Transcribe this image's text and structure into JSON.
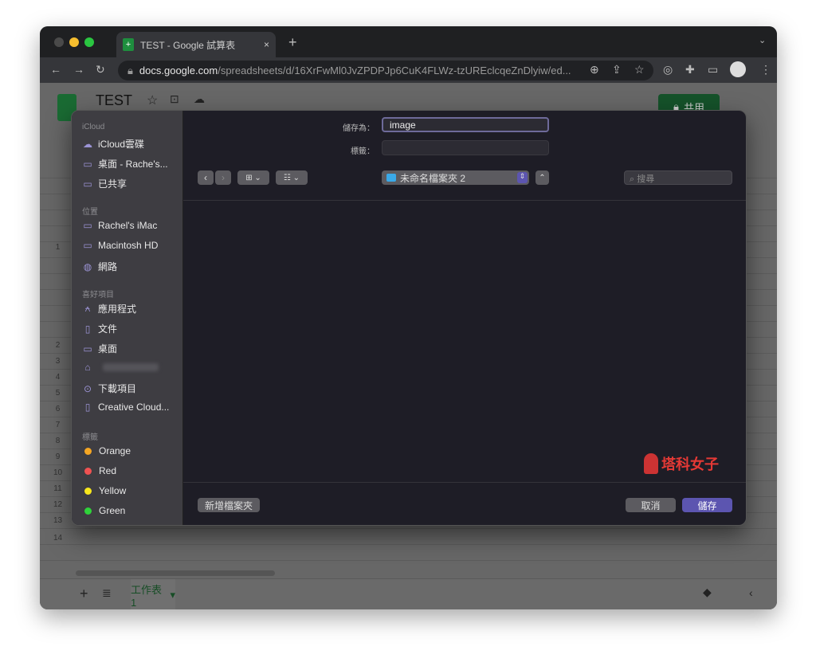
{
  "browser": {
    "tab_title": "TEST - Google 試算表",
    "url_host": "docs.google.com",
    "url_path": "/spreadsheets/d/16XrFwMl0JvZPDPJp6CuK4FLWz-tzUREclcqeZnDlyiw/ed..."
  },
  "sheets": {
    "doc_title": "TEST",
    "share_label": "共用",
    "sheet_tab": "工作表1",
    "row_numbers": [
      "1",
      "2",
      "3",
      "4",
      "5",
      "6",
      "7",
      "8",
      "9",
      "10",
      "11",
      "12",
      "13",
      "14"
    ]
  },
  "dialog": {
    "save_as_label": "儲存為：",
    "save_as_value": "image",
    "tags_label": "標籤：",
    "tags_value": "",
    "folder": "未命名檔案夾 2",
    "search_placeholder": "搜尋",
    "new_folder": "新增檔案夾",
    "cancel": "取消",
    "save": "儲存",
    "watermark": "塔科女子",
    "sidebar": {
      "icloud_header": "iCloud",
      "icloud": [
        "iCloud雲碟",
        "桌面 - Rache's...",
        "已共享"
      ],
      "locations_header": "位置",
      "locations": [
        "Rachel's iMac",
        "Macintosh HD",
        "網路"
      ],
      "favorites_header": "喜好項目",
      "favorites": [
        "應用程式",
        "文件",
        "桌面",
        "",
        "下載項目",
        "Creative Cloud..."
      ],
      "tags_header": "標籤",
      "tags": [
        {
          "name": "Orange",
          "color": "#f5a623"
        },
        {
          "name": "Red",
          "color": "#f05252"
        },
        {
          "name": "Yellow",
          "color": "#f8e71c"
        },
        {
          "name": "Green",
          "color": "#2fd33a"
        }
      ]
    }
  },
  "colors": {
    "accent": "#5c55b0",
    "sheets_green": "#1e8e3e"
  }
}
